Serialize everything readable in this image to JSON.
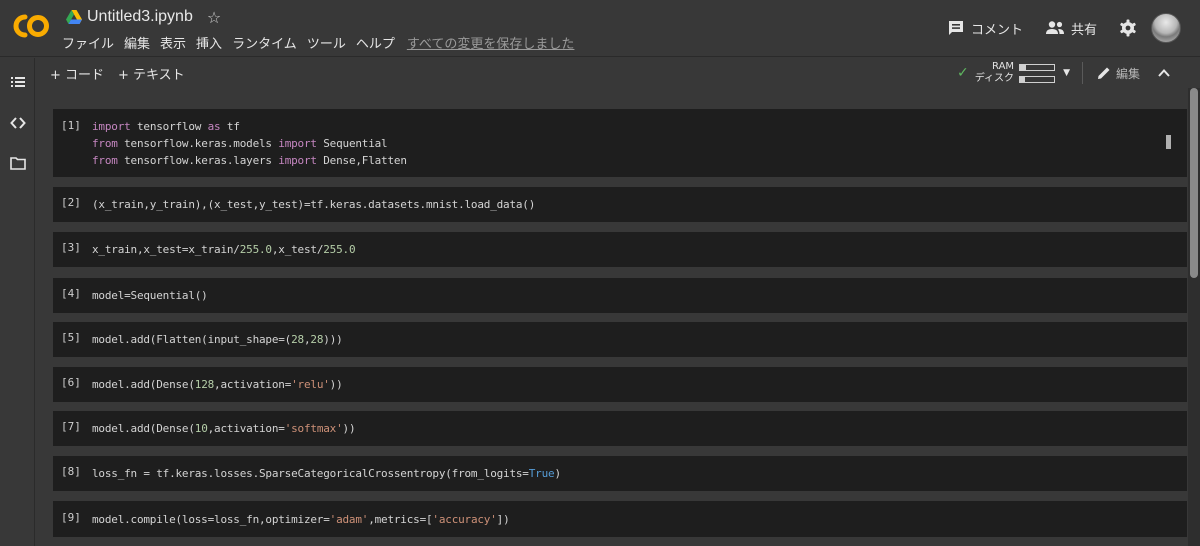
{
  "header": {
    "logo_text": "CO",
    "title": "Untitled3.ipynb",
    "star": "☆",
    "menu": [
      "ファイル",
      "編集",
      "表示",
      "挿入",
      "ランタイム",
      "ツール",
      "ヘルプ"
    ],
    "saved_status": "すべての変更を保存しました",
    "comment_label": "コメント",
    "share_label": "共有"
  },
  "toolbar": {
    "add_code": "+ コード",
    "add_text": "+ テキスト",
    "ram_label": "RAM",
    "disk_label": "ディスク",
    "ram_usage": 0.18,
    "disk_usage": 0.14,
    "edit_label": "編集"
  },
  "cells": [
    {
      "label": "[1]"
    },
    {
      "label": "[2]"
    },
    {
      "label": "[3]"
    },
    {
      "label": "[4]"
    },
    {
      "label": "[5]"
    },
    {
      "label": "[6]"
    },
    {
      "label": "[7]"
    },
    {
      "label": "[8]"
    },
    {
      "label": "[9]"
    }
  ],
  "code": {
    "c1": {
      "l1": [
        "import",
        " tensorflow ",
        "as",
        " tf"
      ],
      "l2": [
        "from",
        " tensorflow.keras.models ",
        "import",
        " Sequential"
      ],
      "l3": [
        "from",
        " tensorflow.keras.layers ",
        "import",
        " Dense,Flatten"
      ]
    },
    "c2": "(x_train,y_train),(x_test,y_test)=tf.keras.datasets.mnist.load_data()",
    "c3": [
      "x_train,x_test=x_train/",
      "255.0",
      ",x_test/",
      "255.0"
    ],
    "c4": "model=Sequential()",
    "c5": [
      "model.add(Flatten(input_shape=(",
      "28",
      ",",
      "28",
      ")))"
    ],
    "c6": [
      "model.add(Dense(",
      "128",
      ",activation=",
      "'relu'",
      "))"
    ],
    "c7": [
      "model.add(Dense(",
      "10",
      ",activation=",
      "'softmax'",
      "))"
    ],
    "c8": [
      "loss_fn = tf.keras.losses.SparseCategoricalCrossentropy(from_logits=",
      "True",
      ")"
    ],
    "c9": [
      "model.compile(loss=loss_fn,optimizer=",
      "'adam'",
      ",metrics=[",
      "'accuracy'",
      "])"
    ]
  },
  "colors": {
    "background": "#383838",
    "cell_background": "#1e1e1e",
    "keyword": "#c586c0",
    "number": "#b5cea8",
    "string": "#ce9178",
    "boolean": "#569cd6",
    "logo": "#f9ab00"
  },
  "icons": [
    "drive-icon",
    "star-icon",
    "comment-icon",
    "share-icon",
    "gear-icon",
    "toc-icon",
    "code-snippets-icon",
    "folder-icon",
    "check-icon",
    "pencil-icon",
    "chevron-up-icon"
  ]
}
